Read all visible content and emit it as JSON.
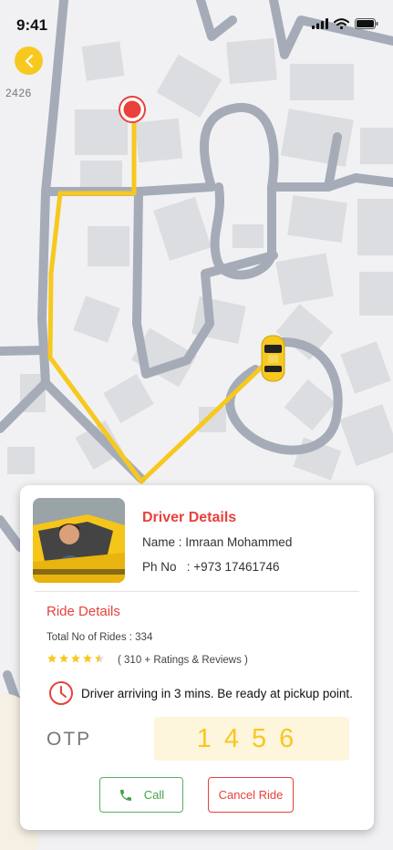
{
  "status_bar": {
    "time": "9:41"
  },
  "map": {
    "road_label": "2426",
    "route_color": "#f7c81e",
    "pin_color": "#e8413c",
    "icons": [
      "back-chevron-icon",
      "location-pin-icon",
      "taxi-car-icon"
    ]
  },
  "driver": {
    "title": "Driver Details",
    "name_label": "Name :",
    "name": "Imraan Mohammed",
    "phone_label": "Ph No",
    "phone": ": +973 17461746"
  },
  "ride": {
    "title": "Ride Details",
    "total_rides": "Total No of Rides : 334",
    "rating_stars": 4.5,
    "rating_text": "( 310 + Ratings & Reviews )",
    "arrival_message": "Driver arriving in 3 mins. Be ready at pickup point."
  },
  "otp": {
    "label": "OTP",
    "code": "1456"
  },
  "actions": {
    "call_label": "Call",
    "cancel_label": "Cancel Ride"
  },
  "colors": {
    "accent": "#f7c81e",
    "danger": "#e8413c",
    "success": "#46a04a"
  }
}
